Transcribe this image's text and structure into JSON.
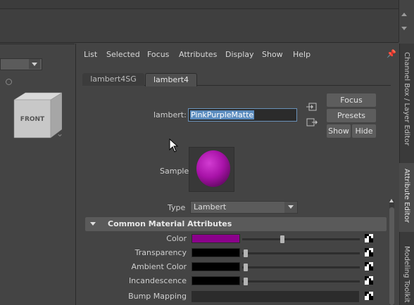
{
  "menu": [
    "List",
    "Selected",
    "Focus",
    "Attributes",
    "Display",
    "Show",
    "Help"
  ],
  "tabs": [
    "lambert4SG",
    "lambert4"
  ],
  "node": {
    "type_label": "lambert:",
    "name": "PinkPurpleMatte"
  },
  "buttons": {
    "focus": "Focus",
    "presets": "Presets",
    "show": "Show",
    "hide": "Hide"
  },
  "sample_label": "Sample",
  "type": {
    "label": "Type",
    "value": "Lambert"
  },
  "viewcube_face": "FRONT",
  "section": {
    "title": "Common Material Attributes"
  },
  "attributes": [
    {
      "label": "Color",
      "swatch": "#8b008b",
      "slider_fraction": 0.32
    },
    {
      "label": "Transparency",
      "swatch": "#000000",
      "slider_fraction": 0.0
    },
    {
      "label": "Ambient Color",
      "swatch": "#000000",
      "slider_fraction": 0.0
    },
    {
      "label": "Incandescence",
      "swatch": "#000000",
      "slider_fraction": 0.0
    },
    {
      "label": "Bump Mapping"
    }
  ],
  "side_tabs": [
    "Channel Box / Layer Editor",
    "Attribute Editor",
    "Modeling Toolkit"
  ],
  "colors": {
    "accent_selection": "#5b8cbf",
    "material": "#a812a8"
  }
}
